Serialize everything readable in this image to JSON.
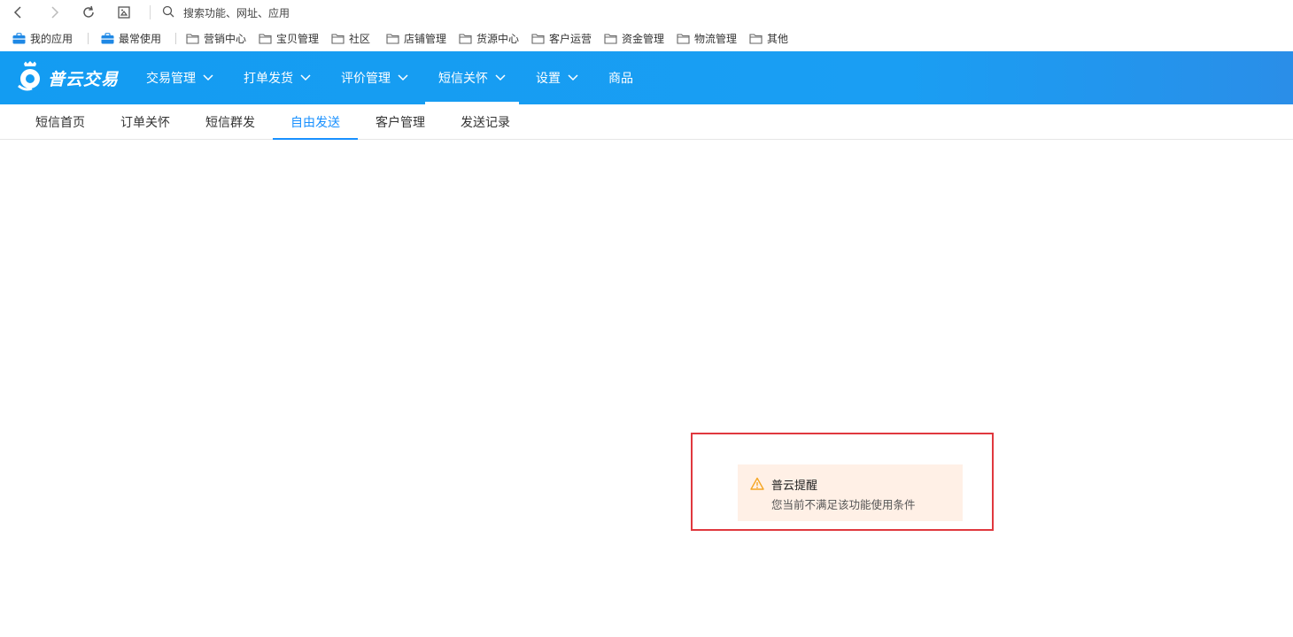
{
  "browser": {
    "address_placeholder": "搜索功能、网址、应用",
    "icons": [
      "back-icon",
      "forward-icon",
      "reload-icon",
      "screenshot-icon",
      "search-icon"
    ]
  },
  "bookmarks": [
    {
      "label": "我的应用",
      "icon": "briefcase-icon"
    },
    {
      "label": "最常使用",
      "icon": "briefcase-icon"
    },
    {
      "label": "营销中心",
      "icon": "folder-icon"
    },
    {
      "label": "宝贝管理",
      "icon": "folder-icon"
    },
    {
      "label": "社区",
      "icon": "folder-icon"
    },
    {
      "label": "店铺管理",
      "icon": "folder-icon"
    },
    {
      "label": "货源中心",
      "icon": "folder-icon"
    },
    {
      "label": "客户运营",
      "icon": "folder-icon"
    },
    {
      "label": "资金管理",
      "icon": "folder-icon"
    },
    {
      "label": "物流管理",
      "icon": "folder-icon"
    },
    {
      "label": "其他",
      "icon": "folder-icon"
    }
  ],
  "app": {
    "logo_text": "普云交易",
    "menu": [
      {
        "label": "交易管理",
        "dropdown": true
      },
      {
        "label": "打单发货",
        "dropdown": true
      },
      {
        "label": "评价管理",
        "dropdown": true
      },
      {
        "label": "短信关怀",
        "dropdown": true,
        "active": true
      },
      {
        "label": "设置",
        "dropdown": true
      },
      {
        "label": "商品",
        "dropdown": false
      }
    ],
    "tabs": [
      {
        "label": "短信首页"
      },
      {
        "label": "订单关怀"
      },
      {
        "label": "短信群发"
      },
      {
        "label": "自由发送",
        "active": true
      },
      {
        "label": "客户管理"
      },
      {
        "label": "发送记录"
      }
    ]
  },
  "notice": {
    "title": "普云提醒",
    "message": "您当前不满足该功能使用条件",
    "icon": "warning-icon"
  },
  "colors": {
    "header_blue": "#139cf2",
    "tab_active": "#1890ff",
    "notice_bg": "#fff0e6",
    "warning": "#f5a623",
    "highlight_border": "#e0383e"
  }
}
